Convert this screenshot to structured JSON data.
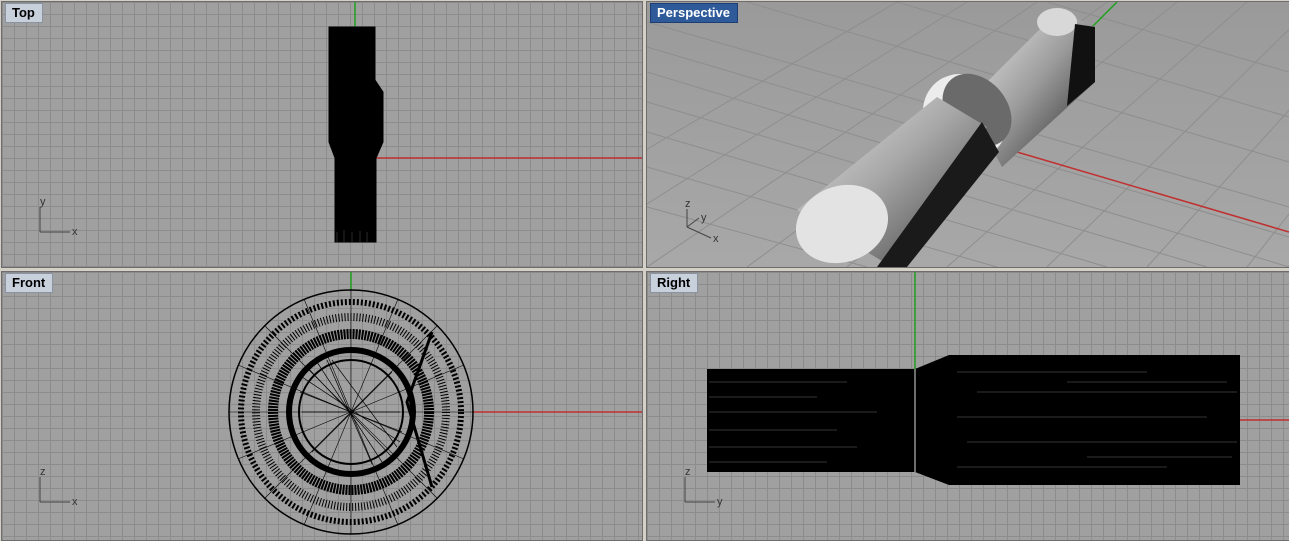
{
  "viewports": {
    "top": {
      "label": "Top",
      "axes": [
        "y",
        "x"
      ]
    },
    "perspective": {
      "label": "Perspective",
      "axes": [
        "z",
        "y",
        "x"
      ]
    },
    "front": {
      "label": "Front",
      "axes": [
        "z",
        "x"
      ]
    },
    "right": {
      "label": "Right",
      "axes": [
        "z",
        "y"
      ]
    }
  },
  "colors": {
    "grid_bg": "#a0a0a0",
    "grid_line": "#8c8c8c",
    "x_axis": "#c03030",
    "y_axis": "#20a020",
    "active_label_bg": "#2e5a9a",
    "label_bg": "#c8d0dc"
  }
}
